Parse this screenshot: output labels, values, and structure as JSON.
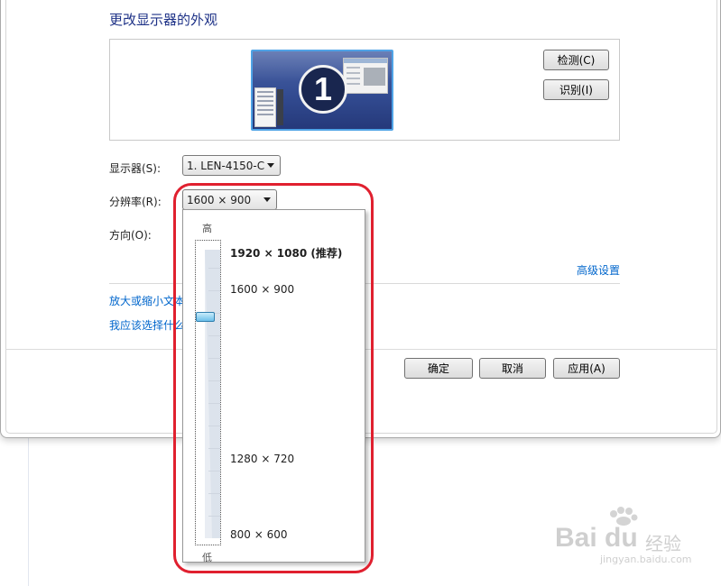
{
  "page_title": "更改显示器的外观",
  "preview": {
    "monitor_number": "1",
    "detect_button": "检测(C)",
    "identify_button": "识别(I)"
  },
  "display": {
    "label": "显示器(S):",
    "value": "1. LEN-4150-C"
  },
  "resolution": {
    "label": "分辨率(R):",
    "value": "1600 × 900",
    "dropdown": {
      "high_label": "高",
      "low_label": "低",
      "options": [
        {
          "text": "1920 × 1080 (推荐)",
          "recommended": true
        },
        {
          "text": "1600 × 900",
          "selected": true
        },
        {
          "text": "1280 × 720"
        },
        {
          "text": "800 × 600"
        }
      ]
    }
  },
  "orientation": {
    "label": "方向(O):"
  },
  "advanced_link": "高级设置",
  "links": {
    "enlarge_text": "放大或缩小文本",
    "which_settings": "我应该选择什么"
  },
  "footer": {
    "ok": "确定",
    "cancel": "取消",
    "apply": "应用(A)"
  },
  "watermark": {
    "brand": "Bai du",
    "brand_cn": "经验",
    "url": "jingyan.baidu.com"
  },
  "colors": {
    "title": "#1e3287",
    "link": "#0066cc",
    "highlight": "#e0202f"
  }
}
